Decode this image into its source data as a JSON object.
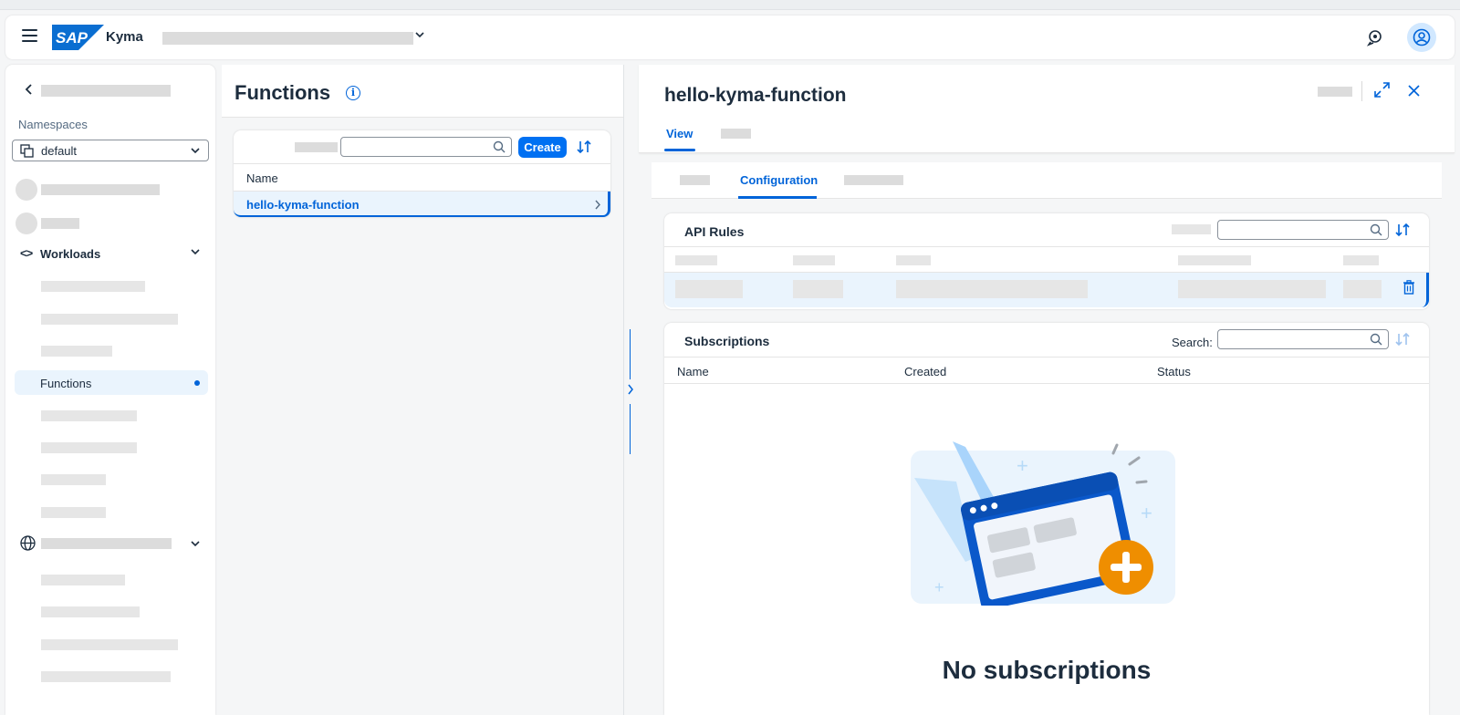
{
  "shell": {
    "product_name": "Kyma",
    "logo_text": "SAP",
    "brand_color": "#0070f2"
  },
  "sidebar": {
    "namespaces_label": "Namespaces",
    "namespace_value": "default",
    "workloads_label": "Workloads",
    "active_item": "Functions"
  },
  "list": {
    "title": "Functions",
    "create_label": "Create",
    "column_name": "Name",
    "rows": [
      "hello-kyma-function"
    ]
  },
  "detail": {
    "title": "hello-kyma-function",
    "tab_view": "View",
    "subtab_active": "Configuration",
    "api_rules_title": "API Rules",
    "subscriptions_title": "Subscriptions",
    "search_label": "Search:",
    "columns": [
      "Name",
      "Created",
      "Status"
    ],
    "empty_text": "No subscriptions"
  }
}
